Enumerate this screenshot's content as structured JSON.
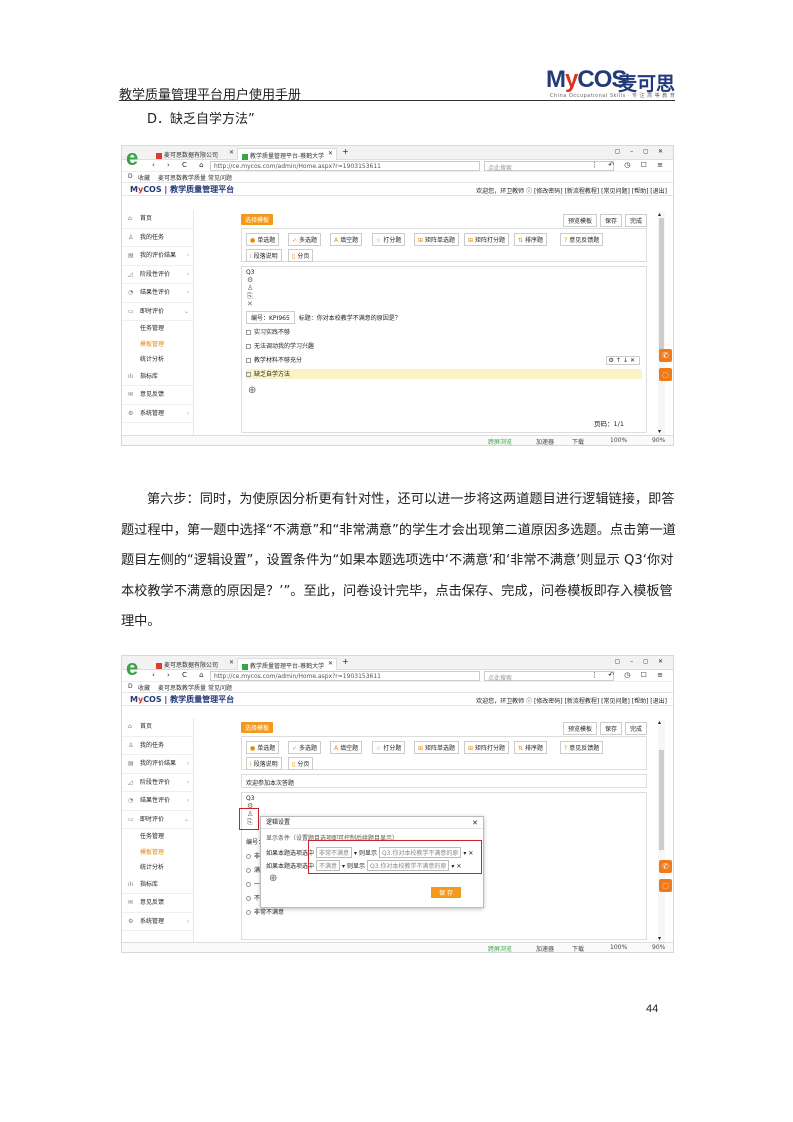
{
  "header": {
    "title": "教学质量管理平台用户使用手册",
    "logo_my": "M",
    "logo_y": "y",
    "logo_cos": "COS",
    "logo_cn": "麦可思",
    "logo_sub": "China Occupational Skills · 专 注 高 等 教 育"
  },
  "line_d": "D．缺乏自学方法”",
  "paragraph": "第六步：同时，为使原因分析更有针对性，还可以进一步将这两道题目进行逻辑链接，即答题过程中，第一题中选择“不满意”和“非常满意”的学生才会出现第二道原因多选题。点击第一道题目左侧的“逻辑设置”，设置条件为“如果本题选项选中‘不满意’和‘非常不满意’则显示 Q3‘你对本校教学不满意的原因是？’”。至此，问卷设计完毕，点击保存、完成，问卷模板即存入模板管理中。",
  "page_number": "44",
  "browser": {
    "tab1": "麦可思数据有限公司",
    "tab2": "教学质量管理平台-蔡鹤大学",
    "url": "http://ce.mycos.com/admin/Home.aspx?r=1903153611",
    "search": "点此搜索",
    "bookmarks": [
      "收藏",
      "麦可思数",
      "教学质量",
      "常见问题"
    ],
    "nav_glyphs": "‹ › C ⌂",
    "tool_glyphs": "⋮ ↶ ◷ ☐ ≡",
    "win_glyphs": "▢ – ◻ ✕"
  },
  "app": {
    "logo_my": "M",
    "logo_y": "y",
    "logo_rest": "COS | 教学质量管理平台",
    "user_bar": "欢迎您，环卫教师 ⓘ  [修改密码] [新流程教程] [常见问题] [帮助] [退出]",
    "nav": [
      {
        "label": "首页",
        "icon": "⌂"
      },
      {
        "label": "我的任务",
        "icon": "♙"
      },
      {
        "label": "我的评价结果",
        "icon": "▤"
      },
      {
        "label": "阶段性评价",
        "icon": "◿"
      },
      {
        "label": "结果性评价",
        "icon": "◔"
      },
      {
        "label": "即时评价",
        "icon": "▭"
      }
    ],
    "subnav": [
      "任务管理",
      "模板管理",
      "统计分析"
    ],
    "nav_after": [
      {
        "label": "指标库",
        "icon": "ılı"
      },
      {
        "label": "意见反馈",
        "icon": "✉"
      },
      {
        "label": "系统管理",
        "icon": "⚙"
      }
    ],
    "main_tag": "选择模板",
    "buttons": [
      "预览模板",
      "保存",
      "完成"
    ],
    "qtypes": [
      {
        "icon": "●",
        "label": "单选题"
      },
      {
        "icon": "✓",
        "label": "多选题"
      },
      {
        "icon": "A",
        "label": "填空题"
      },
      {
        "icon": "☆",
        "label": "打分题"
      },
      {
        "icon": "⊞",
        "label": "矩阵单选题"
      },
      {
        "icon": "⊞",
        "label": "矩阵打分题"
      },
      {
        "icon": "⇅",
        "label": "排序题"
      },
      {
        "icon": "?",
        "label": "意见反馈题"
      }
    ],
    "qtypes2": [
      {
        "icon": "i",
        "label": "段落说明"
      },
      {
        "icon": "▯",
        "label": "分页"
      }
    ],
    "question": {
      "num": "Q3",
      "code": "编号：KPI965",
      "title": "标题：你对本校教学不满意的原因是？",
      "options": [
        "实习实践不够",
        "无法调动我的学习兴趣",
        "教学材料不够充分",
        "缺乏自学方法"
      ]
    },
    "page_info": "页码：1/1",
    "welcome_text": "欢迎参加本次答题",
    "shot2_options": [
      "不满意",
      "非常不满意"
    ],
    "shot2_partial": [
      "编号：",
      "非",
      "满",
      "一"
    ],
    "status": [
      "跨屏浏览",
      "加速器",
      "下载",
      "100%",
      "90%"
    ]
  },
  "dialog": {
    "title": "逻辑设置",
    "hint": "显示条件（设置题目选项即可控制后续题目显示）",
    "rows": [
      {
        "lead": "如果本题选项选中",
        "opt": "非常不满意",
        "mid": "则显示",
        "target": "Q3.你对本校教学不满意的原"
      },
      {
        "lead": "如果本题选项选中",
        "opt": "不满意",
        "mid": "则显示",
        "target": "Q3.你对本校教学不满意的原"
      }
    ],
    "save": "保 存"
  }
}
